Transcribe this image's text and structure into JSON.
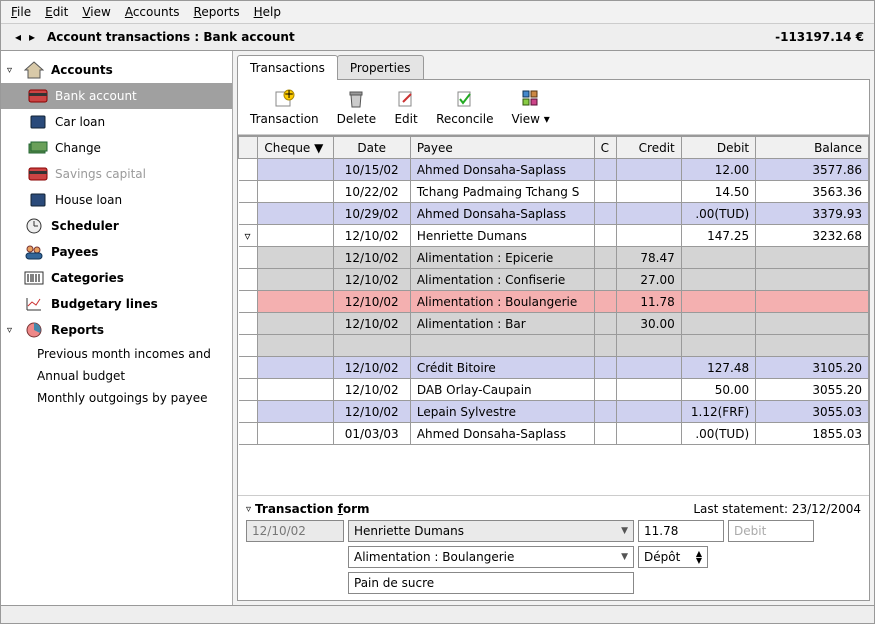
{
  "menu": [
    "File",
    "Edit",
    "View",
    "Accounts",
    "Reports",
    "Help"
  ],
  "title": "Account transactions : Bank account",
  "balance": "-113197.14 €",
  "sidebar": {
    "accounts": {
      "label": "Accounts",
      "items": [
        {
          "label": "Bank account"
        },
        {
          "label": "Car loan"
        },
        {
          "label": "Change"
        },
        {
          "label": "Savings capital"
        },
        {
          "label": "House loan"
        }
      ]
    },
    "scheduler": "Scheduler",
    "payees": "Payees",
    "categories": "Categories",
    "budgetary": "Budgetary lines",
    "reports": {
      "label": "Reports",
      "items": [
        "Previous month incomes and",
        "Annual budget",
        "Monthly outgoings by payee"
      ]
    }
  },
  "tabs": [
    "Transactions",
    "Properties"
  ],
  "toolbar": [
    "Transaction",
    "Delete",
    "Edit",
    "Reconcile",
    "View"
  ],
  "columns": [
    "",
    "Cheque ▼",
    "Date",
    "Payee",
    "C",
    "Credit",
    "Debit",
    "Balance"
  ],
  "rows": [
    {
      "cls": "blue",
      "date": "10/15/02",
      "payee": "Ahmed Donsaha-Saplass",
      "credit": "",
      "debit": "12.00",
      "bal": "3577.86"
    },
    {
      "cls": "white",
      "date": "10/22/02",
      "payee": "Tchang Padmaing Tchang S",
      "credit": "",
      "debit": "14.50",
      "bal": "3563.36"
    },
    {
      "cls": "blue",
      "date": "10/29/02",
      "payee": "Ahmed Donsaha-Saplass",
      "credit": "",
      "debit": ".00(TUD)",
      "bal": "3379.93"
    },
    {
      "cls": "white",
      "date": "12/10/02",
      "payee": "Henriette Dumans",
      "credit": "",
      "debit": "147.25",
      "bal": "3232.68",
      "h": "▿"
    },
    {
      "cls": "gray",
      "date": "12/10/02",
      "payee": "Alimentation : Epicerie",
      "credit": "78.47",
      "debit": "",
      "bal": ""
    },
    {
      "cls": "gray",
      "date": "12/10/02",
      "payee": "Alimentation : Confiserie",
      "credit": "27.00",
      "debit": "",
      "bal": ""
    },
    {
      "cls": "pink",
      "date": "12/10/02",
      "payee": "Alimentation : Boulangerie",
      "credit": "11.78",
      "debit": "",
      "bal": ""
    },
    {
      "cls": "gray",
      "date": "12/10/02",
      "payee": "Alimentation : Bar",
      "credit": "30.00",
      "debit": "",
      "bal": ""
    },
    {
      "cls": "gray",
      "date": "",
      "payee": "",
      "credit": "",
      "debit": "",
      "bal": ""
    },
    {
      "cls": "blue",
      "date": "12/10/02",
      "payee": "Crédit Bitoire",
      "credit": "",
      "debit": "127.48",
      "bal": "3105.20"
    },
    {
      "cls": "white",
      "date": "12/10/02",
      "payee": "DAB Orlay-Caupain",
      "credit": "",
      "debit": "50.00",
      "bal": "3055.20"
    },
    {
      "cls": "blue",
      "date": "12/10/02",
      "payee": "Lepain Sylvestre",
      "credit": "",
      "debit": "1.12(FRF)",
      "bal": "3055.03"
    },
    {
      "cls": "white",
      "date": "01/03/03",
      "payee": "Ahmed Donsaha-Saplass",
      "credit": "",
      "debit": ".00(TUD)",
      "bal": "1855.03"
    }
  ],
  "form": {
    "title": "Transaction form",
    "statement": "Last statement: 23/12/2004",
    "date": "12/10/02",
    "payee": "Henriette Dumans",
    "amount": "11.78",
    "debit_ph": "Debit",
    "category": "Alimentation : Boulangerie",
    "type": "Dépôt",
    "memo": "Pain de sucre"
  }
}
